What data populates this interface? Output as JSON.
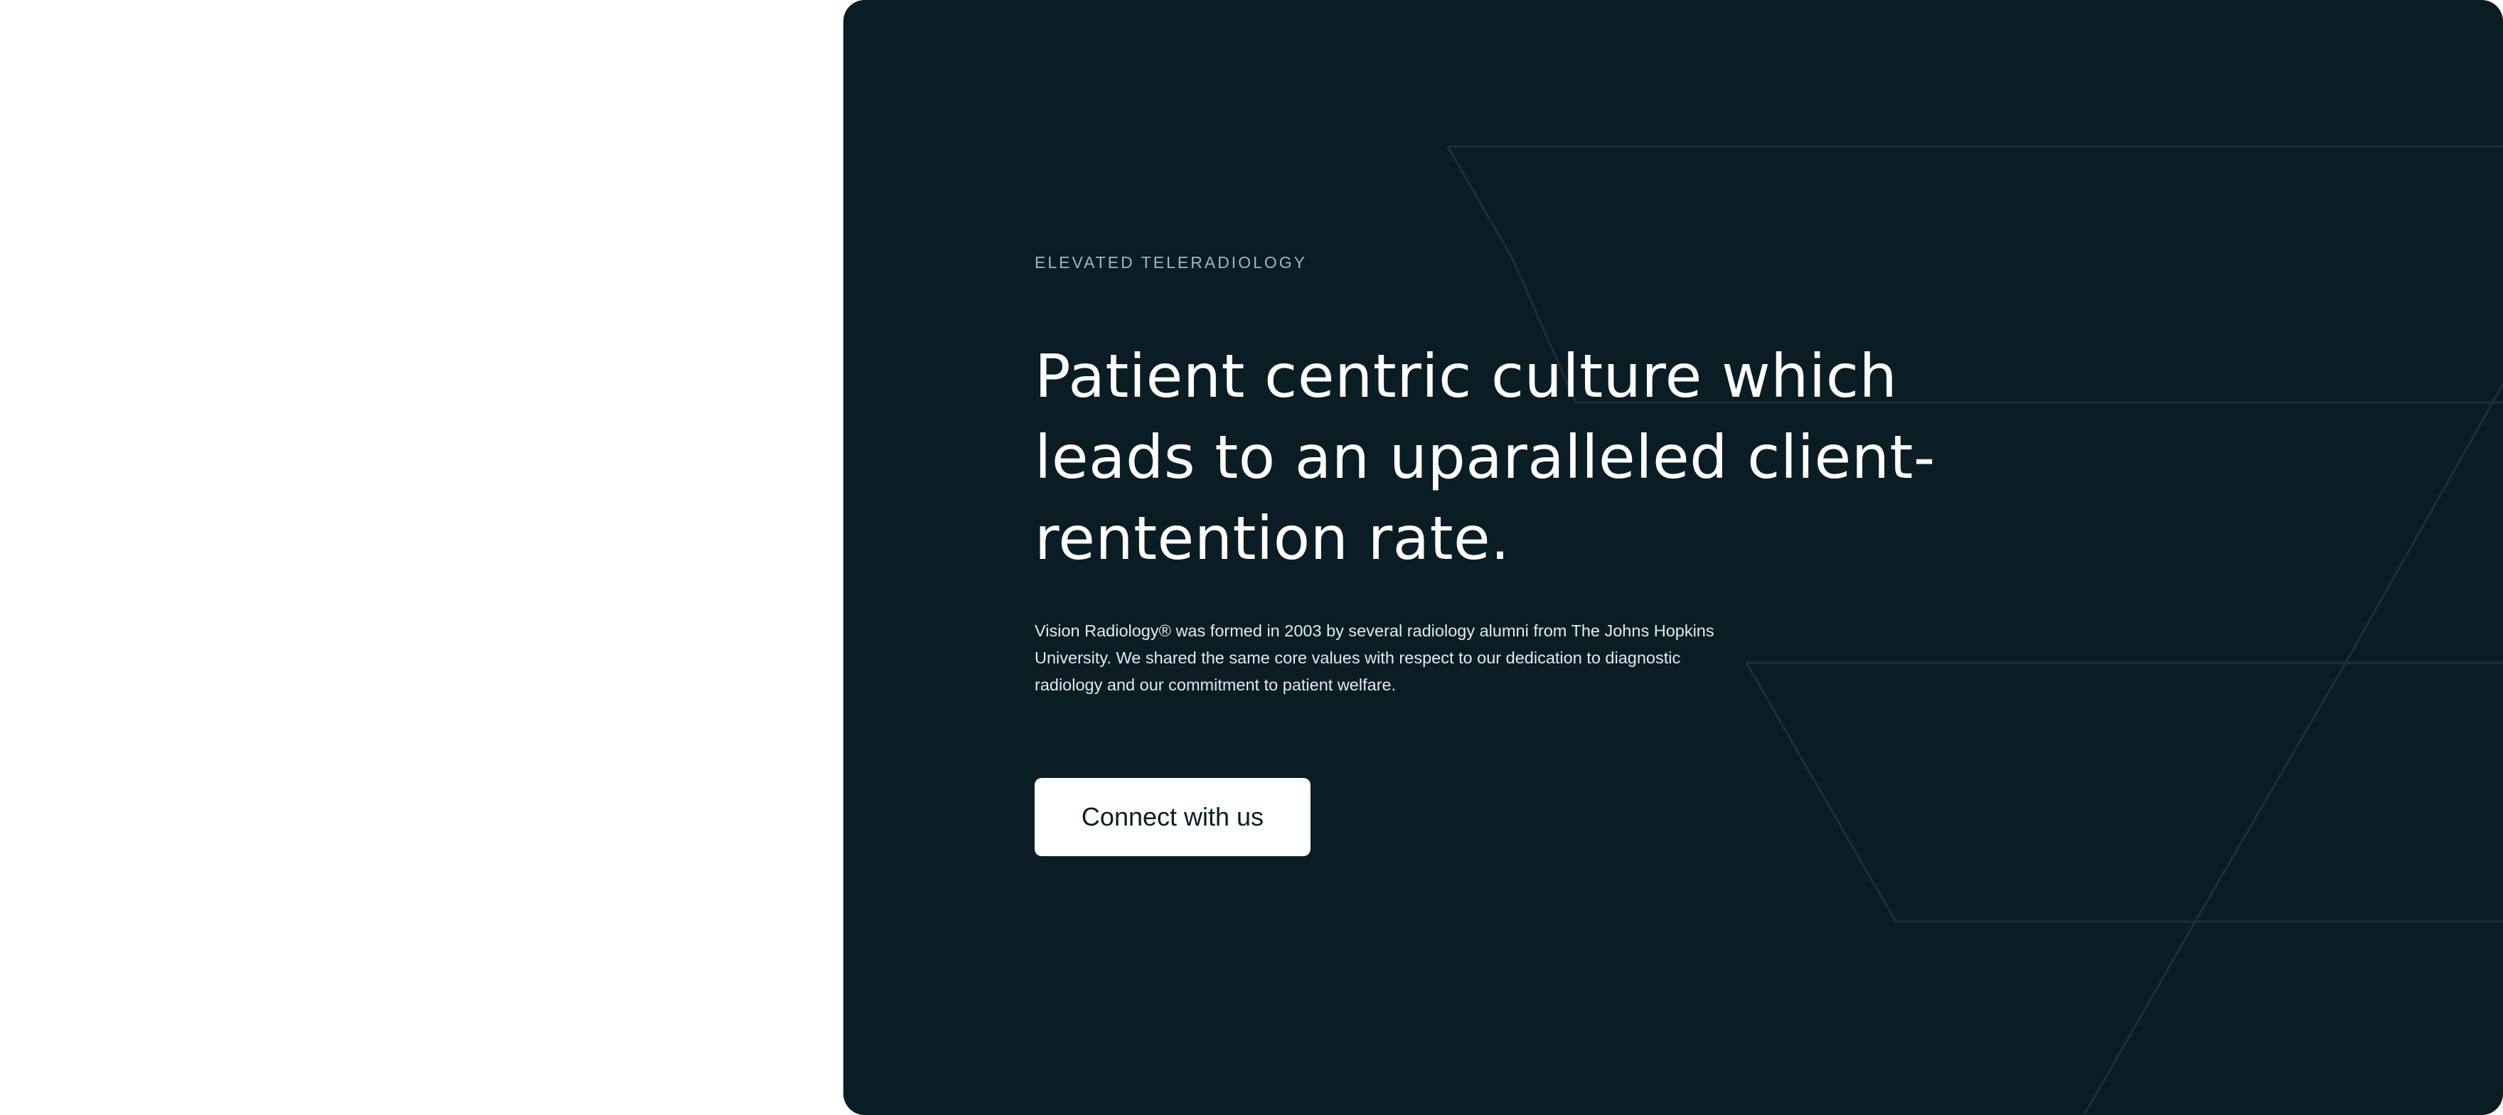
{
  "hero": {
    "eyebrow": "ELEVATED TELERADIOLOGY",
    "headline": "Patient centric culture which leads to an uparalleled client-rentention rate.",
    "body": "Vision Radiology® was formed in 2003 by several radiology alumni from The Johns Hopkins University. We shared the same core values with respect to our dedication to diagnostic radiology and our commitment to patient welfare.",
    "cta_label": "Connect with us"
  },
  "colors": {
    "card_background": "#0a1d25",
    "pattern_line": "#1c3039",
    "button_background": "#ffffff",
    "button_text": "#0a1d25"
  }
}
